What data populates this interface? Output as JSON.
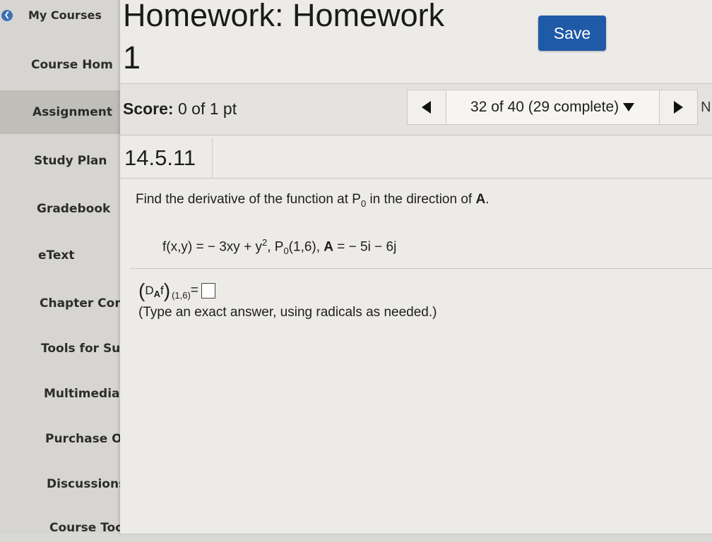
{
  "sidebar": {
    "items": [
      {
        "label": "My Courses"
      },
      {
        "label": "Course Hom"
      },
      {
        "label": "Assignment"
      },
      {
        "label": "Study Plan"
      },
      {
        "label": "Gradebook"
      },
      {
        "label": "eText"
      },
      {
        "label": "Chapter Cor"
      },
      {
        "label": "Tools for Su"
      },
      {
        "label": "Multimedia"
      },
      {
        "label": "Purchase O"
      },
      {
        "label": "Discussions"
      },
      {
        "label": "Course Tool"
      }
    ],
    "active_index": 2
  },
  "header": {
    "title_line1": "Homework: Homework",
    "title_line2": "1",
    "save_label": "Save"
  },
  "toolbar": {
    "score_label": "Score:",
    "score_value": "0 of 1 pt",
    "question_selector": "32 of 40 (29 complete)",
    "next_edge_text": "N"
  },
  "question": {
    "number": "14.5.11",
    "prompt_text": "Find the derivative of the function at P",
    "prompt_sub": "0",
    "prompt_tail": " in the direction of ",
    "prompt_bold": "A",
    "prompt_end": ".",
    "function_lhs": "f(x,y) = − 3xy + y",
    "function_sup": "2",
    "point_label": ",   P",
    "point_sub": "0",
    "point_value": "(1,6),  ",
    "vector_label": "A",
    "vector_value": " = − 5i − 6j",
    "answer_paren_open": "(",
    "answer_d": "D",
    "answer_a": "A",
    "answer_f": "f",
    "answer_paren_close": ")",
    "answer_point": "(1,6)",
    "answer_equals": " =",
    "hint": "(Type an exact answer, using radicals as needed.)"
  },
  "colors": {
    "save_button": "#1f5aa6",
    "sidebar_bg": "#d6d5d1",
    "main_bg": "#ecebe8",
    "back_icon": "#3d6fb5"
  }
}
